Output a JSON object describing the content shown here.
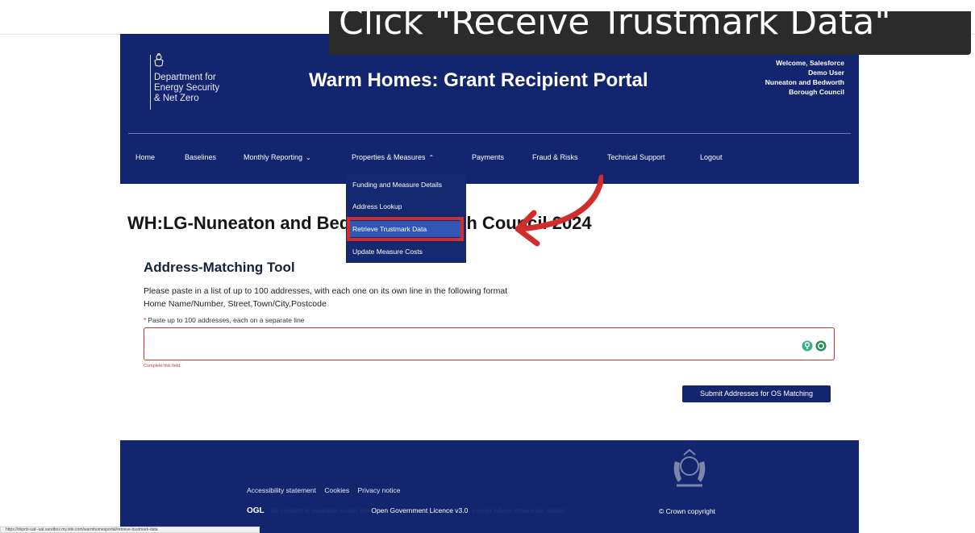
{
  "caption": {
    "text": "Click \"Receive Trustmark Data\""
  },
  "header": {
    "dept_lines": [
      "Department for",
      "Energy Security",
      "& Net Zero"
    ],
    "title": "Warm Homes: Grant Recipient Portal",
    "welcome_lines": [
      "Welcome, Salesforce",
      "Demo User",
      "Nuneaton and Bedworth",
      "Borough Council"
    ]
  },
  "nav": {
    "items": [
      {
        "label": "Home"
      },
      {
        "label": "Baselines"
      },
      {
        "label": "Monthly Reporting",
        "chevron": "chevron-down-icon"
      },
      {
        "label": "Properties & Measures",
        "chevron": "chevron-up-icon"
      },
      {
        "label": "Payments"
      },
      {
        "label": "Fraud & Risks"
      },
      {
        "label": "Technical Support"
      },
      {
        "label": "Logout"
      }
    ]
  },
  "dropdown": {
    "items": [
      {
        "label": "Funding and Measure Details"
      },
      {
        "label": "Address Lookup"
      },
      {
        "label": "Retrieve Trustmark Data",
        "selected": true
      },
      {
        "label": "Update Measure Costs"
      }
    ]
  },
  "page": {
    "title": "WH:LG-Nuneaton and Bedworth Borough Council 2024"
  },
  "tool": {
    "title": "Address-Matching Tool",
    "instructions": [
      "Please paste in a list of up to 100 addresses, with each one on its own line in the following format",
      "Home Name/Number, Street,Town/City,Postcode"
    ],
    "field_label": "Paste up to 100 addresses, each on a separate line",
    "required_marker": "*",
    "error": "Complete this field.",
    "submit_label": "Submit Addresses for OS Matching"
  },
  "footer": {
    "links": [
      "Accessibility statement",
      "Cookies",
      "Privacy notice"
    ],
    "ogl": "OGL",
    "licence_prefix": "All content is available under the",
    "licence_link": "Open Government Licence v3.0",
    "licence_suffix": ", except where otherwise stated",
    "copyright": "© Crown copyright"
  },
  "status_url": "https://dsprtz-uat--uat.sandbox.my.site.com/warmhomesportal/retrieve-trustmark-data",
  "colors": {
    "navy": "#13256e",
    "highlight": "#d12d2d",
    "selected": "#2f56b5",
    "error": "#c23934"
  }
}
